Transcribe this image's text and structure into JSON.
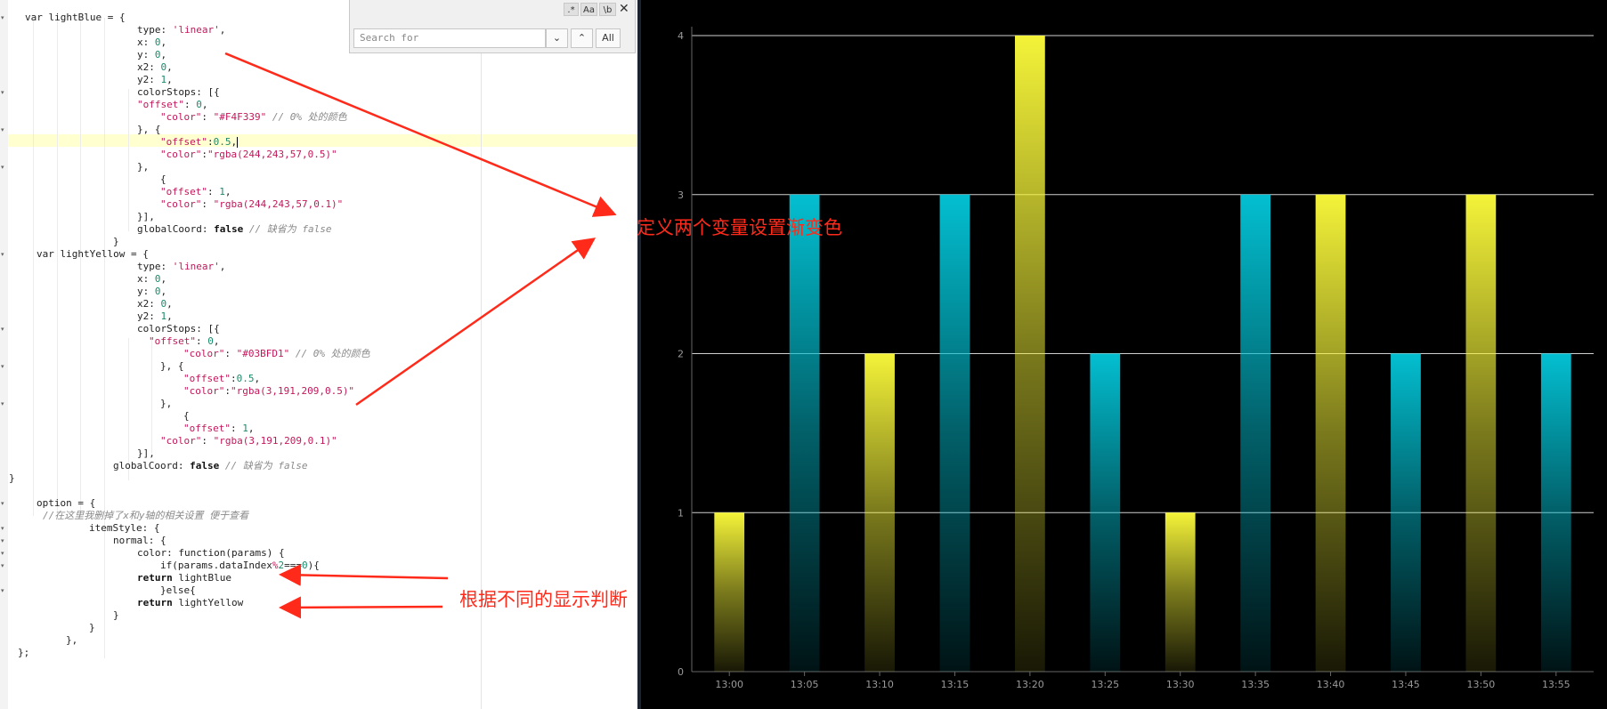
{
  "editor": {
    "lines": [
      [
        [
          "p",
          "var lightBlue = {"
        ]
      ],
      [
        [
          "p",
          "type: "
        ],
        [
          "s",
          "'linear'"
        ],
        [
          "p",
          ","
        ]
      ],
      [
        [
          "p",
          "x: "
        ],
        [
          "n",
          "0"
        ],
        [
          "p",
          ","
        ]
      ],
      [
        [
          "p",
          "y: "
        ],
        [
          "n",
          "0"
        ],
        [
          "p",
          ","
        ]
      ],
      [
        [
          "p",
          "x2: "
        ],
        [
          "n",
          "0"
        ],
        [
          "p",
          ","
        ]
      ],
      [
        [
          "p",
          "y2: "
        ],
        [
          "n",
          "1"
        ],
        [
          "p",
          ","
        ]
      ],
      [
        [
          "p",
          "colorStops: [{"
        ]
      ],
      [
        [
          "s",
          "\"offset\""
        ],
        [
          "p",
          ": "
        ],
        [
          "n",
          "0"
        ],
        [
          "p",
          ","
        ]
      ],
      [
        [
          "s",
          "\"color\""
        ],
        [
          "p",
          ": "
        ],
        [
          "s",
          "\"#F4F339\""
        ],
        [
          "p",
          " "
        ],
        [
          "c",
          "// 0% 处的颜色"
        ]
      ],
      [
        [
          "p",
          "}, {"
        ]
      ],
      [
        [
          "s",
          "\"offset\""
        ],
        [
          "p",
          ":"
        ],
        [
          "n",
          "0.5"
        ],
        [
          "p",
          ","
        ]
      ],
      [
        [
          "s",
          "\"color\""
        ],
        [
          "p",
          ":"
        ],
        [
          "s",
          "\"rgba(244,243,57,0.5)\""
        ]
      ],
      [
        [
          "p",
          "},"
        ]
      ],
      [
        [
          "p",
          "{"
        ]
      ],
      [
        [
          "s",
          "\"offset\""
        ],
        [
          "p",
          ": "
        ],
        [
          "n",
          "1"
        ],
        [
          "p",
          ","
        ]
      ],
      [
        [
          "s",
          "\"color\""
        ],
        [
          "p",
          ": "
        ],
        [
          "s",
          "\"rgba(244,243,57,0.1)\""
        ]
      ],
      [
        [
          "p",
          "}],"
        ]
      ],
      [
        [
          "p",
          "globalCoord: "
        ],
        [
          "k",
          "false"
        ],
        [
          "p",
          " "
        ],
        [
          "c",
          "// 缺省为 false"
        ]
      ],
      [
        [
          "p",
          "}"
        ]
      ],
      [
        [
          "p",
          "var lightYellow = {"
        ]
      ],
      [
        [
          "p",
          "type: "
        ],
        [
          "s",
          "'linear'"
        ],
        [
          "p",
          ","
        ]
      ],
      [
        [
          "p",
          "x: "
        ],
        [
          "n",
          "0"
        ],
        [
          "p",
          ","
        ]
      ],
      [
        [
          "p",
          "y: "
        ],
        [
          "n",
          "0"
        ],
        [
          "p",
          ","
        ]
      ],
      [
        [
          "p",
          "x2: "
        ],
        [
          "n",
          "0"
        ],
        [
          "p",
          ","
        ]
      ],
      [
        [
          "p",
          "y2: "
        ],
        [
          "n",
          "1"
        ],
        [
          "p",
          ","
        ]
      ],
      [
        [
          "p",
          "colorStops: [{"
        ]
      ],
      [
        [
          "s",
          "\"offset\""
        ],
        [
          "p",
          ": "
        ],
        [
          "n",
          "0"
        ],
        [
          "p",
          ","
        ]
      ],
      [
        [
          "s",
          "\"color\""
        ],
        [
          "p",
          ": "
        ],
        [
          "s",
          "\"#03BFD1\""
        ],
        [
          "p",
          " "
        ],
        [
          "c",
          "// 0% 处的颜色"
        ]
      ],
      [
        [
          "p",
          "}, {"
        ]
      ],
      [
        [
          "s",
          "\"offset\""
        ],
        [
          "p",
          ":"
        ],
        [
          "n",
          "0.5"
        ],
        [
          "p",
          ","
        ]
      ],
      [
        [
          "s",
          "\"color\""
        ],
        [
          "p",
          ":"
        ],
        [
          "s",
          "\"rgba(3,191,209,0.5)\""
        ]
      ],
      [
        [
          "p",
          "},"
        ]
      ],
      [
        [
          "p",
          "{"
        ]
      ],
      [
        [
          "s",
          "\"offset\""
        ],
        [
          "p",
          ": "
        ],
        [
          "n",
          "1"
        ],
        [
          "p",
          ","
        ]
      ],
      [
        [
          "s",
          "\"color\""
        ],
        [
          "p",
          ": "
        ],
        [
          "s",
          "\"rgba(3,191,209,0.1)\""
        ]
      ],
      [
        [
          "p",
          "}],"
        ]
      ],
      [
        [
          "p",
          "globalCoord: "
        ],
        [
          "k",
          "false"
        ],
        [
          "p",
          " "
        ],
        [
          "c",
          "// 缺省为 false"
        ]
      ],
      [
        [
          "p",
          "}"
        ]
      ],
      [
        [
          "p",
          ""
        ]
      ],
      [
        [
          "p",
          "option = {"
        ]
      ],
      [
        [
          "c",
          "//在这里我删掉了x和y轴的相关设置 便于查看"
        ]
      ],
      [
        [
          "p",
          "itemStyle: {"
        ]
      ],
      [
        [
          "p",
          "normal: {"
        ]
      ],
      [
        [
          "p",
          "color: function(params) {"
        ]
      ],
      [
        [
          "p",
          "if(params.dataIndex"
        ],
        [
          "s",
          "%"
        ],
        [
          "n",
          "2"
        ],
        [
          "p",
          "==="
        ],
        [
          "n",
          "0"
        ],
        [
          "p",
          "){"
        ]
      ],
      [
        [
          "k",
          "return"
        ],
        [
          "p",
          " lightBlue"
        ]
      ],
      [
        [
          "p",
          "}else{"
        ]
      ],
      [
        [
          "k",
          "return"
        ],
        [
          "p",
          " lightYellow"
        ]
      ],
      [
        [
          "p",
          "}"
        ]
      ],
      [
        [
          "p",
          "}"
        ]
      ],
      [
        [
          "p",
          "},"
        ]
      ],
      [
        [
          "p",
          "};"
        ]
      ]
    ]
  },
  "find_bar": {
    "toggle_regex": ".*",
    "toggle_case": "Aa",
    "toggle_word": "\\b",
    "close": "✕",
    "search_placeholder": "Search for",
    "prev_button": "⌄",
    "next_button": "⌃",
    "all_button": "All"
  },
  "annotations": {
    "gradient_note": "定义两个变量设置渐变色",
    "logic_note": "根据不同的显示判断"
  },
  "colors": {
    "annotation_red": "#ff2a1a",
    "bar_yellow": "#F4F339",
    "bar_cyan": "#03BFD1",
    "chart_background": "#000000",
    "grid_line": "#cfcfcf"
  },
  "chart_data": {
    "type": "bar",
    "categories": [
      "13:00",
      "13:05",
      "13:10",
      "13:15",
      "13:20",
      "13:25",
      "13:30",
      "13:35",
      "13:40",
      "13:45",
      "13:50",
      "13:55"
    ],
    "values": [
      1,
      3,
      2,
      3,
      4,
      2,
      1,
      3,
      3,
      2,
      3,
      2
    ],
    "bar_colors": [
      "yellow",
      "cyan",
      "yellow",
      "cyan",
      "yellow",
      "cyan",
      "yellow",
      "cyan",
      "yellow",
      "cyan",
      "yellow",
      "cyan"
    ],
    "y_ticks": [
      "0",
      "1",
      "2",
      "3",
      "4"
    ],
    "ylim": [
      0,
      4
    ],
    "title": "",
    "xlabel": "",
    "ylabel": "",
    "grid": true,
    "gradient": "vertical, opaque at top fading toward bottom"
  }
}
